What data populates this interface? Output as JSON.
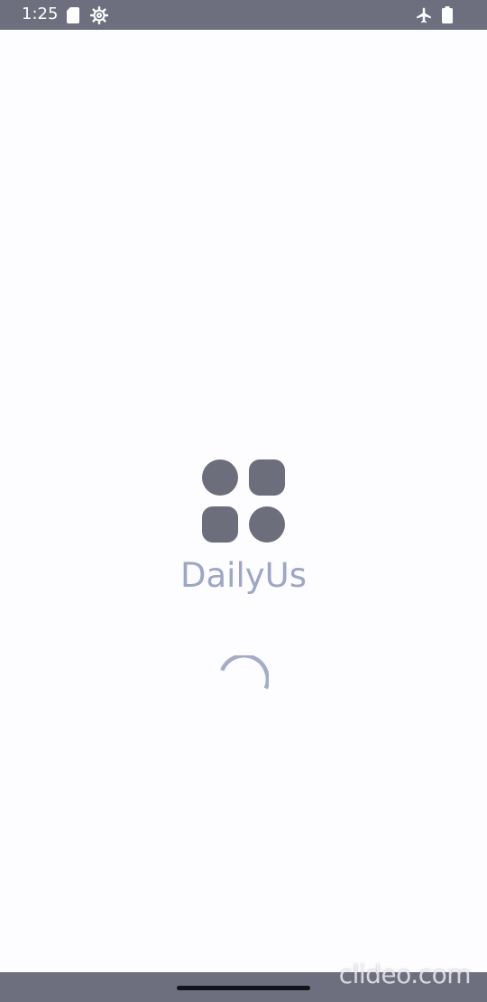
{
  "status_bar": {
    "time": "1:25",
    "left_icons": [
      "sd-card-icon",
      "gear-icon"
    ],
    "right_icons": [
      "airplane-icon",
      "battery-icon"
    ],
    "background_color": "#6d6f7e"
  },
  "splash": {
    "app_name": "DailyUs",
    "logo_icon": "four-shapes-logo-icon",
    "logo_color": "#6c6e7c",
    "app_name_color": "#9ca6c6",
    "loading_indicator": "spinner-icon",
    "spinner_color": "#a3acc8"
  },
  "navigation_bar": {
    "gesture_handle": "home-handle"
  },
  "watermark": {
    "text": "clideo.com"
  }
}
